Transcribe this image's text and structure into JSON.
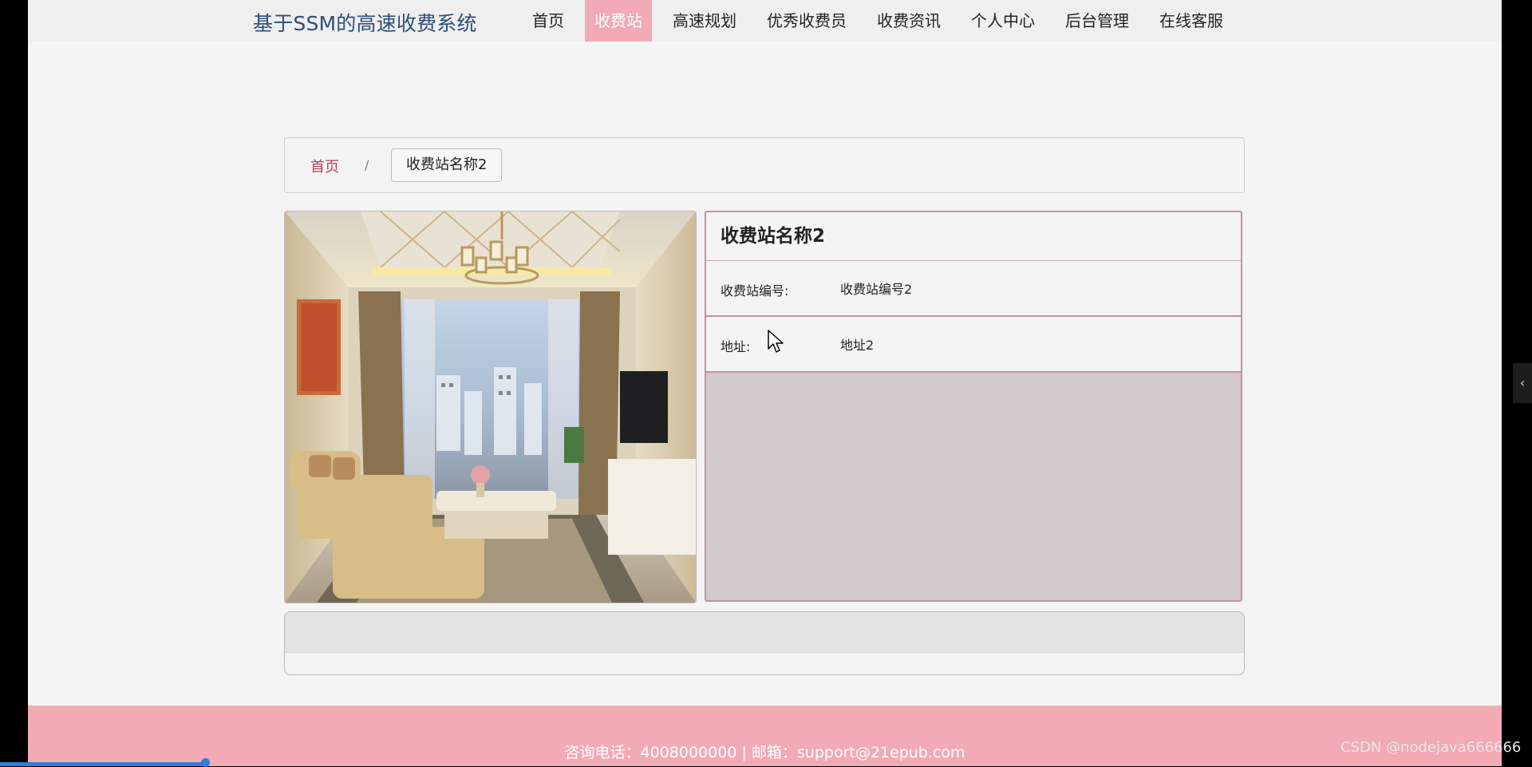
{
  "header": {
    "brand": "基于SSM的高速收费系统",
    "menu": [
      {
        "label": "首页"
      },
      {
        "label": "收费站",
        "active": true
      },
      {
        "label": "高速规划"
      },
      {
        "label": "优秀收费员"
      },
      {
        "label": "收费资讯"
      },
      {
        "label": "个人中心"
      },
      {
        "label": "后台管理"
      },
      {
        "label": "在线客服"
      }
    ]
  },
  "breadcrumb": {
    "home": "首页",
    "separator": "/",
    "current": "收费站名称2"
  },
  "detail": {
    "image_icon": "living-room-photo",
    "title": "收费站名称2",
    "rows": [
      {
        "label": "收费站编号:",
        "value": "收费站编号2"
      },
      {
        "label": "地址:",
        "value": "地址2"
      }
    ]
  },
  "footer": {
    "text": "咨询电话：4008000000 | 邮箱：support@21epub.com"
  },
  "overlay": {
    "side_toggle": "‹",
    "watermark": "CSDN @nodejava666666"
  },
  "colors": {
    "brand": "#2c4d7b",
    "accent_pink": "#f1aab6",
    "link_red": "#b44050",
    "panel_border": "#c5929b"
  }
}
